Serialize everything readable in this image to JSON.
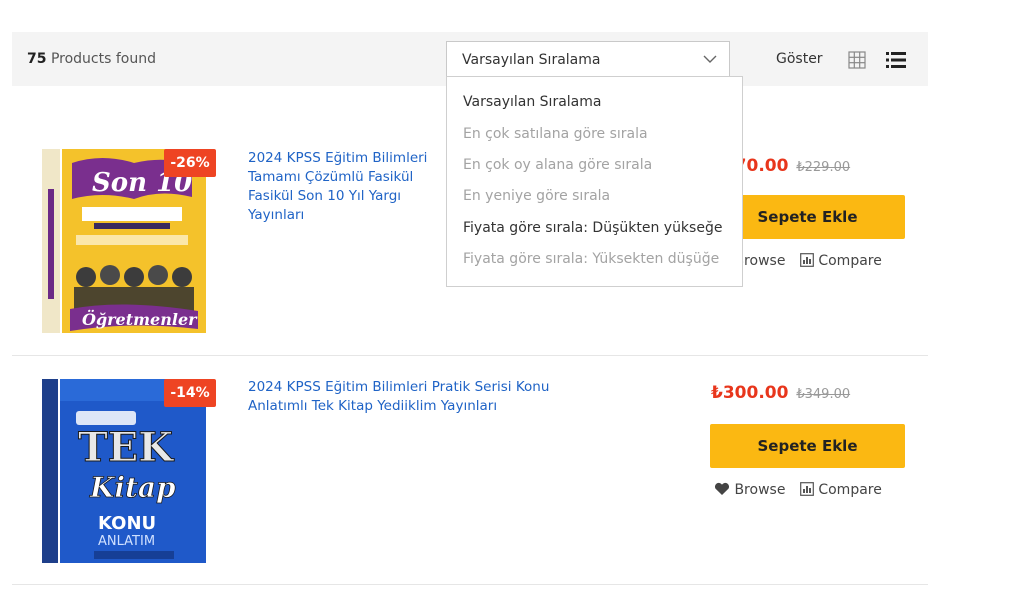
{
  "toolbar": {
    "count": "75",
    "found_label": "Products found",
    "sort_selected": "Varsayılan Sıralama",
    "show_label": "Göster"
  },
  "sort_options": [
    "Varsayılan Sıralama",
    "En çok satılana göre sırala",
    "En çok oy alana göre sırala",
    "En yeniye göre sırala",
    "Fiyata göre sırala: Düşükten yükseğe",
    "Fiyata göre sırala: Yüksekten düşüğe"
  ],
  "products": [
    {
      "title": "2024 KPSS Eğitim Bilimleri Tamamı Çözümlü Fasikül Fasikül Son 10 Yıl Yargı Yayınları",
      "discount": "-26%",
      "price": "₺170.00",
      "old_price": "₺229.00",
      "cart_label": "Sepete Ekle",
      "browse_label": "Browse",
      "compare_label": "Compare",
      "cover_colors": {
        "bg": "#f4c22b",
        "accent": "#7a2f8e"
      }
    },
    {
      "title": "2024 KPSS Eğitim Bilimleri Pratik Serisi Konu Anlatımlı Tek Kitap Yediiklim Yayınları",
      "discount": "-14%",
      "price": "₺300.00",
      "old_price": "₺349.00",
      "cart_label": "Sepete Ekle",
      "browse_label": "Browse",
      "compare_label": "Compare",
      "cover_colors": {
        "bg": "#1f59c9",
        "accent": "#ffffff"
      }
    }
  ],
  "colors": {
    "accent_button": "#fbb812",
    "sale_badge": "#ee4423",
    "link": "#1f63c6",
    "price": "#e8361c"
  },
  "icons": {
    "dropdown": "chevron-down-icon",
    "grid_view": "grid-icon",
    "list_view": "list-icon",
    "browse": "heart-icon",
    "compare": "compare-icon"
  }
}
